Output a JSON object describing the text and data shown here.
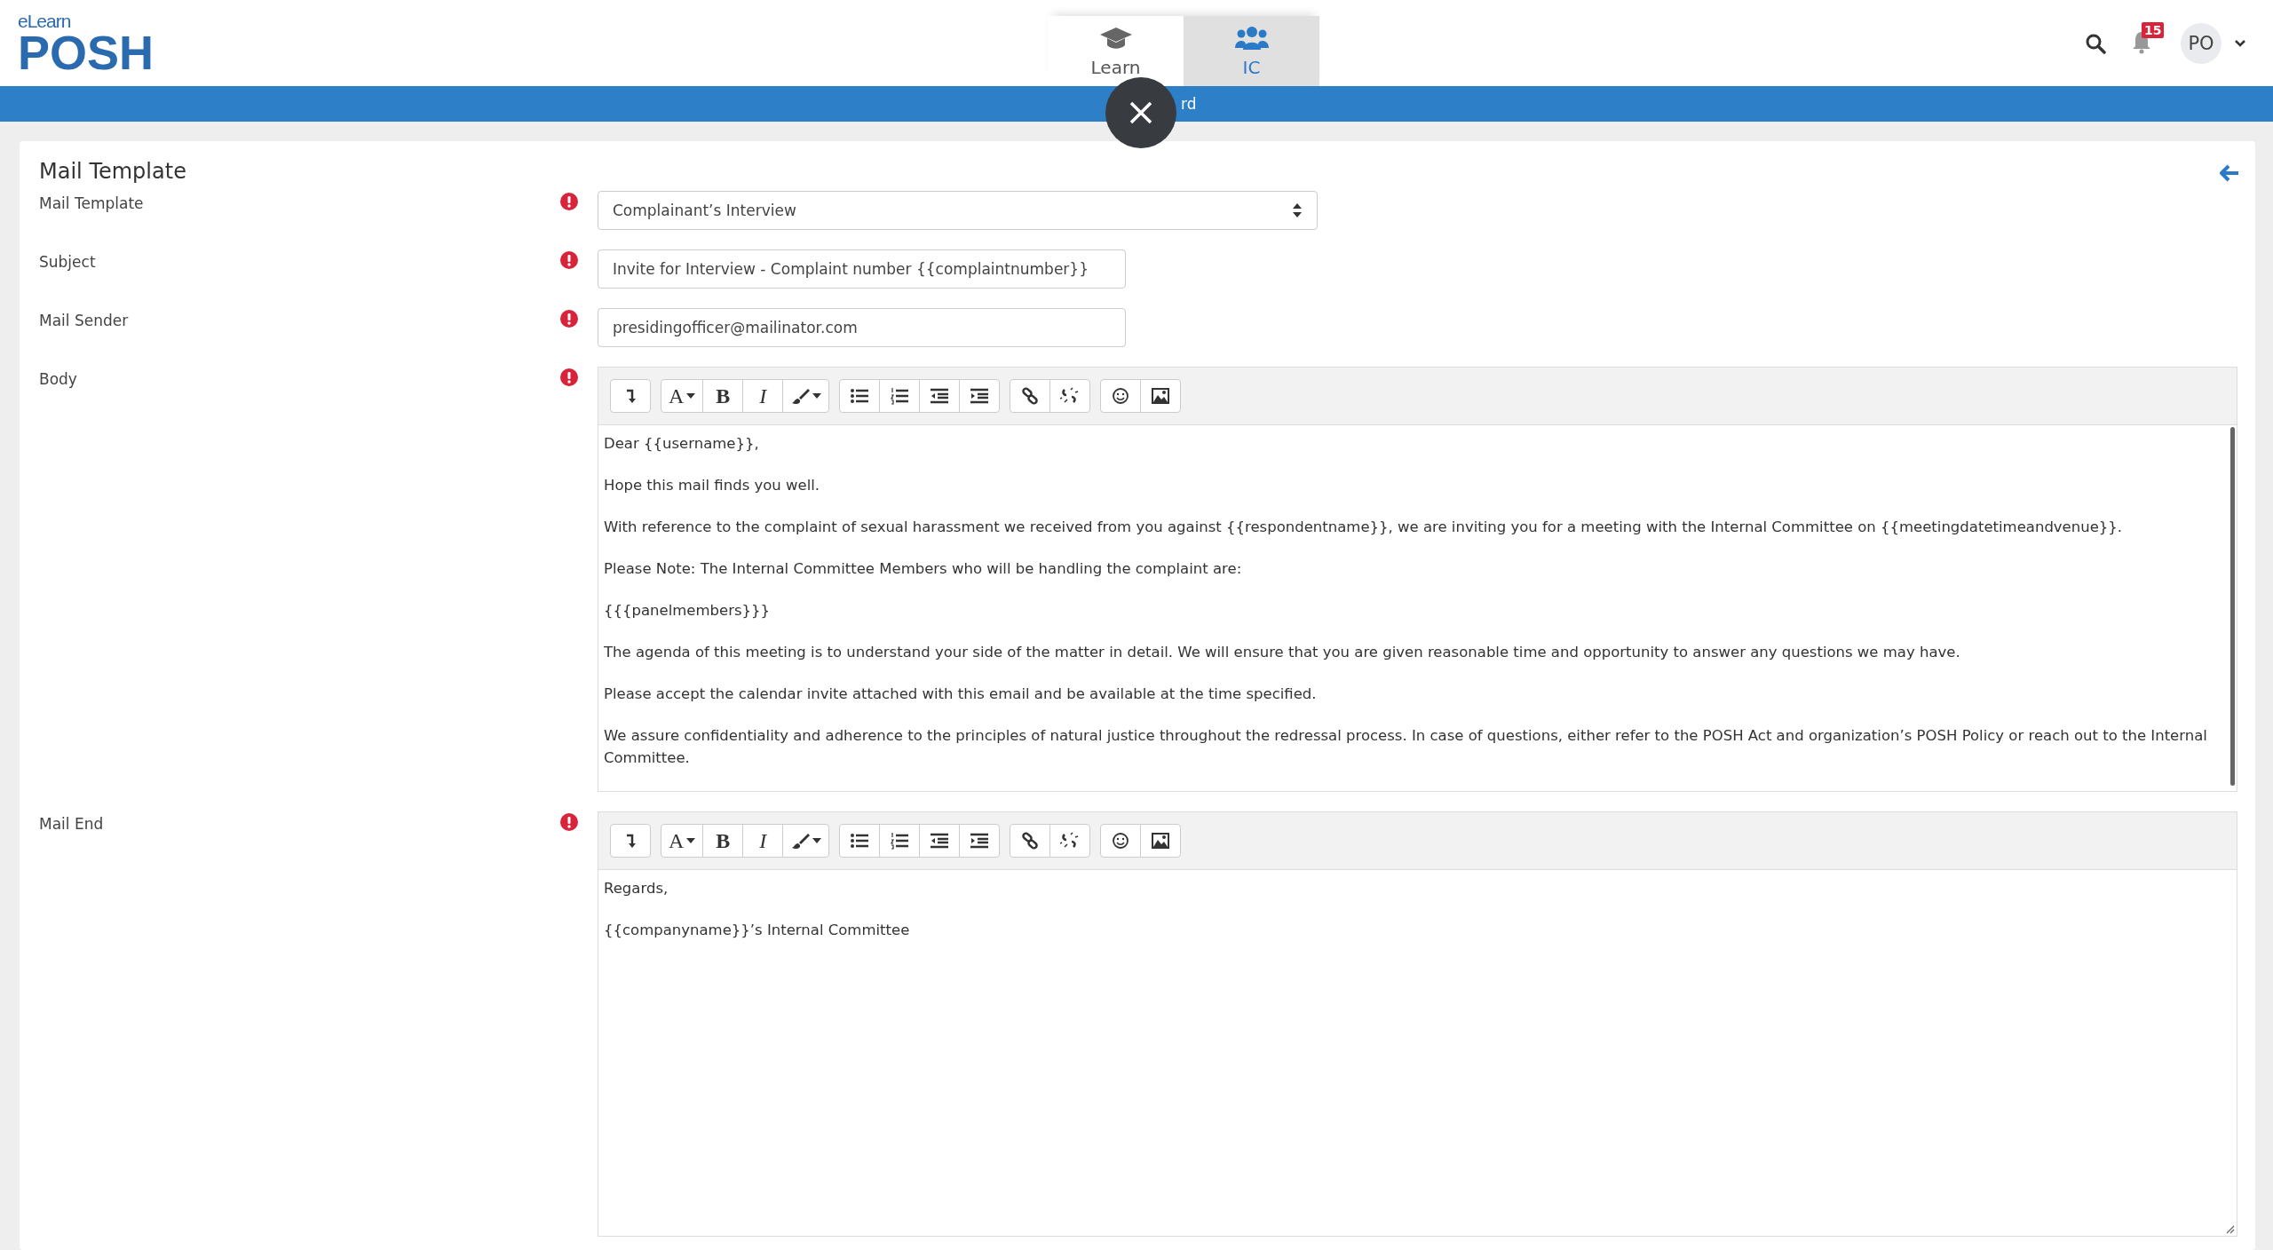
{
  "header": {
    "logo_small": "eLearn",
    "logo_big": "POSH",
    "tabs": [
      {
        "label": "Learn",
        "kind": "cap",
        "selected": false
      },
      {
        "label": "IC",
        "kind": "users",
        "selected": true
      }
    ],
    "notification_count": "15",
    "avatar": "PO"
  },
  "nav_bar": {
    "label": "rd"
  },
  "form": {
    "title": "Mail Template",
    "fields": [
      {
        "label": "Mail Template",
        "required": true,
        "kind": "select",
        "value": "Complainant’s Interview"
      },
      {
        "label": "Subject",
        "required": true,
        "kind": "input",
        "value": "Invite for Interview - Complaint number {{complaintnumber}}"
      },
      {
        "label": "Mail Sender",
        "required": true,
        "kind": "input",
        "value": "presidingofficer@mailinator.com"
      },
      {
        "label": "Body",
        "required": true,
        "kind": "editor",
        "toolbar": [
          [
            {
              "kind": "enter"
            }
          ],
          [
            {
              "kind": "font",
              "label": "A"
            },
            {
              "kind": "bold",
              "label": "B"
            },
            {
              "kind": "italic",
              "label": "I"
            },
            {
              "kind": "color"
            }
          ],
          [
            {
              "kind": "bullets"
            },
            {
              "kind": "numbers"
            },
            {
              "kind": "outdent"
            },
            {
              "kind": "indent"
            }
          ],
          [
            {
              "kind": "link"
            },
            {
              "kind": "unlink"
            }
          ],
          [
            {
              "kind": "emoji"
            },
            {
              "kind": "image"
            }
          ]
        ],
        "paragraphs": [
          "Dear {{username}},",
          "Hope this mail finds you well.",
          "With reference to the complaint of sexual harassment we received from you against {{respondentname}}, we are inviting you for a meeting with the Internal Committee on {{meetingdatetimeandvenue}}.",
          "Please Note: The Internal Committee Members who will be handling the complaint are:",
          "{{{panelmembers}}}",
          "The agenda of this meeting is to understand your side of the matter in detail. We will ensure that you are given reasonable time and opportunity to answer any questions we may have.",
          "Please accept the calendar invite attached with this email and be available at the time specified.",
          "We assure confidentiality and adherence to the principles of natural justice throughout the redressal process. In case of questions, either refer to the POSH Act and organization’s POSH Policy or reach out to the Internal Committee."
        ]
      },
      {
        "label": "Mail End",
        "required": true,
        "kind": "editor",
        "toolbar": [
          [
            {
              "kind": "enter"
            }
          ],
          [
            {
              "kind": "font",
              "label": "A"
            },
            {
              "kind": "bold",
              "label": "B"
            },
            {
              "kind": "italic",
              "label": "I"
            },
            {
              "kind": "color"
            }
          ],
          [
            {
              "kind": "bullets"
            },
            {
              "kind": "numbers"
            },
            {
              "kind": "outdent"
            },
            {
              "kind": "indent"
            }
          ],
          [
            {
              "kind": "link"
            },
            {
              "kind": "unlink"
            }
          ],
          [
            {
              "kind": "emoji"
            },
            {
              "kind": "image"
            }
          ]
        ],
        "paragraphs": [
          "Regards,",
          "{{companyname}}’s Internal Committee"
        ]
      }
    ]
  }
}
